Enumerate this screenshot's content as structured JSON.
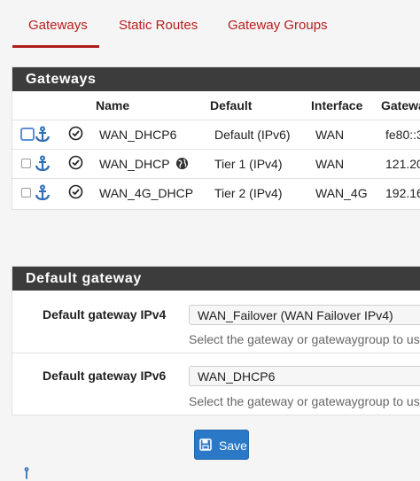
{
  "tabs": [
    {
      "label": "Gateways",
      "active": true
    },
    {
      "label": "Static Routes",
      "active": false
    },
    {
      "label": "Gateway Groups",
      "active": false
    }
  ],
  "gateways_panel": {
    "title": "Gateways",
    "columns": [
      "Name",
      "Default",
      "Interface",
      "Gatewa"
    ],
    "rows": [
      {
        "name": "WAN_DHCP6",
        "default": "Default (IPv6)",
        "interface": "WAN",
        "gateway": "fe80::3"
      },
      {
        "name": "WAN_DHCP",
        "default": "Tier 1 (IPv4)",
        "interface": "WAN",
        "gateway": "121.20"
      },
      {
        "name": "WAN_4G_DHCP",
        "default": "Tier 2 (IPv4)",
        "interface": "WAN_4G",
        "gateway": "192.16"
      }
    ]
  },
  "default_gateway_panel": {
    "title": "Default gateway",
    "ipv4": {
      "label": "Default gateway IPv4",
      "selected": "WAN_Failover (WAN Failover IPv4)",
      "help": "Select the gateway or gatewaygroup to use"
    },
    "ipv6": {
      "label": "Default gateway IPv6",
      "selected": "WAN_DHCP6",
      "help": "Select the gateway or gatewaygroup to use"
    }
  },
  "save_button": {
    "label": "Save"
  },
  "colors": {
    "tab_red": "#ba1c1c",
    "header_dark": "#3c3c3c",
    "save_blue": "#2b78c6",
    "anchor_blue": "#2f6fb4"
  },
  "icons": [
    "anchor-icon",
    "check-circle-icon",
    "globe-icon",
    "save-icon"
  ]
}
